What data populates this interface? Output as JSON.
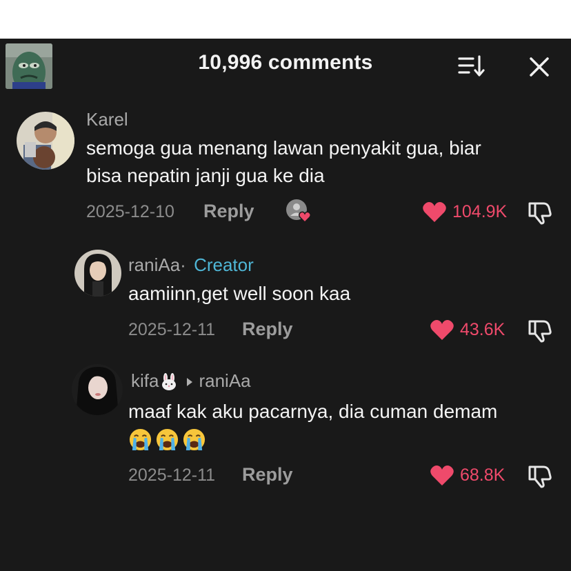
{
  "header": {
    "title": "10,996 comments"
  },
  "comments": [
    {
      "username": "Karel",
      "text_lines": [
        "semoga gua menang lawan penyakit gua, biar",
        "bisa nepatin janji gua ke dia"
      ],
      "date": "2025-12-10",
      "reply_label": "Reply",
      "likes": "104.9K",
      "liked_by_creator": true
    },
    {
      "username": "raniAa",
      "separator": "·",
      "badge": "Creator",
      "text_lines": [
        "aamiinn,get well soon kaa"
      ],
      "date": "2025-12-11",
      "reply_label": "Reply",
      "likes": "43.6K"
    },
    {
      "username": "kifa",
      "reply_to": "raniAa",
      "text_lines": [
        "maaf kak aku pacarnya, dia cuman demam"
      ],
      "emojis": [
        "loudly-crying-face",
        "loudly-crying-face",
        "loudly-crying-face"
      ],
      "date": "2025-12-11",
      "reply_label": "Reply",
      "likes": "68.8K"
    }
  ],
  "colors": {
    "background": "#191919",
    "like": "#ef4a6b",
    "creator_badge": "#4fb6d6"
  }
}
